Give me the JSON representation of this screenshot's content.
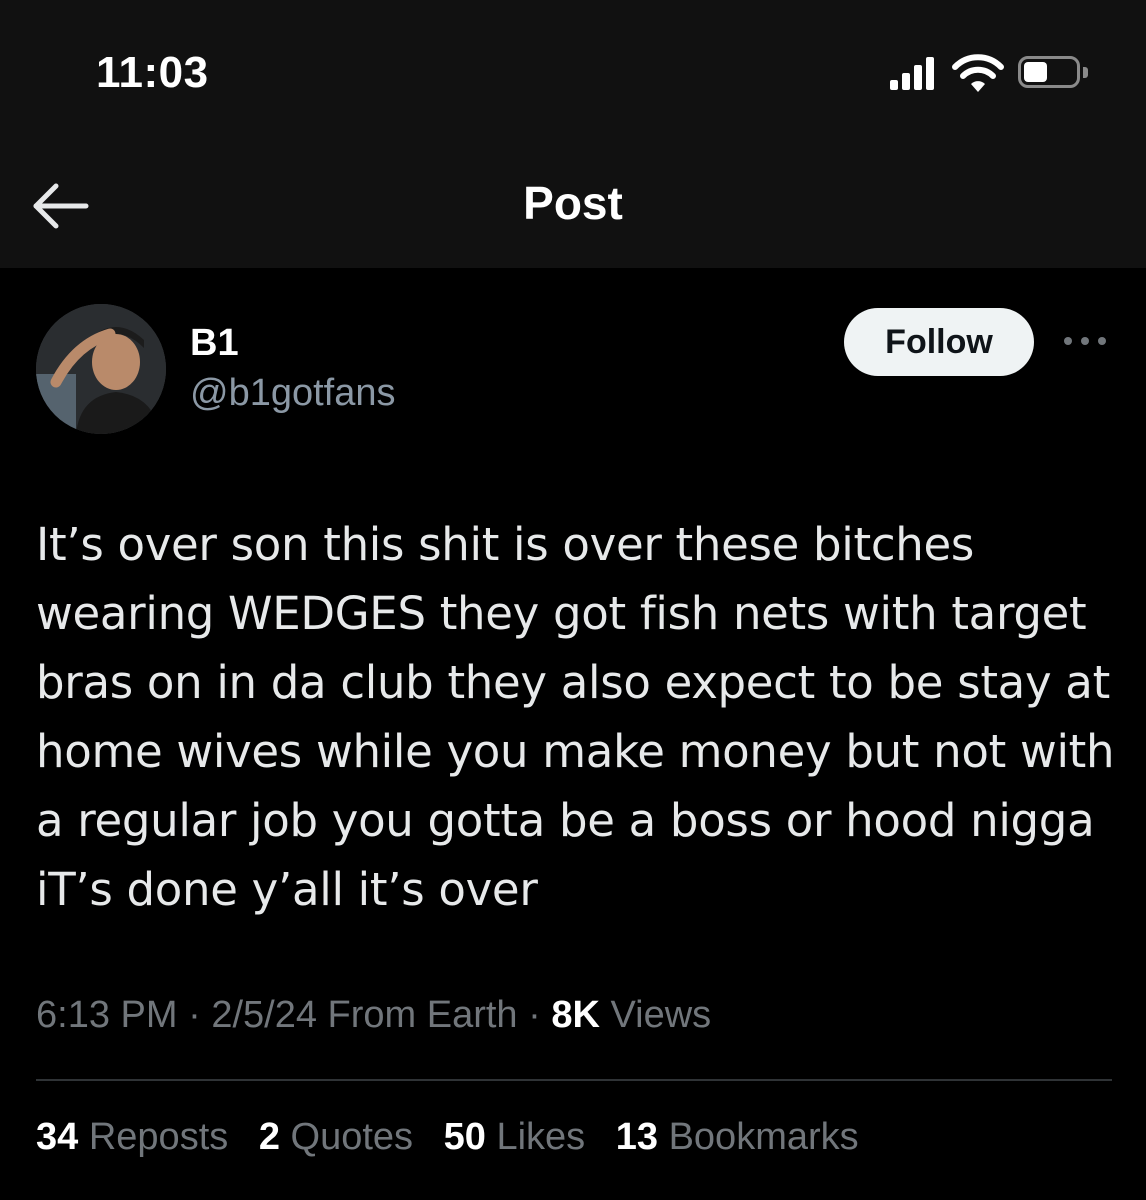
{
  "status_bar": {
    "time": "11:03",
    "signal_bars": 4,
    "battery_level": 0.45
  },
  "header": {
    "title": "Post"
  },
  "author": {
    "name": "B1",
    "handle": "@b1gotfans",
    "follow_label": "Follow"
  },
  "post": {
    "lines": [
      "It’s over son this shit is over these bitches",
      "wearing WEDGES they got fish nets with target",
      "bras on in da club they also expect to be stay at",
      "home wives while you make money but not with",
      "a regular job you gotta be a boss or hood nigga",
      "iT’s done y’all it’s over"
    ]
  },
  "meta": {
    "time": "6:13 PM",
    "separator": "·",
    "date": "2/5/24",
    "location": "From Earth",
    "views_count": "8K",
    "views_label": "Views"
  },
  "stats": {
    "reposts_count": "34",
    "reposts_label": "Reposts",
    "quotes_count": "2",
    "quotes_label": "Quotes",
    "likes_count": "50",
    "likes_label": "Likes",
    "bookmarks_count": "13",
    "bookmarks_label": "Bookmarks"
  },
  "colors": {
    "background": "#000000",
    "header_background": "#111111",
    "primary_text": "#e7e9ea",
    "secondary_text": "#71767b",
    "handle_text": "#8b98a5",
    "follow_bg": "#eff3f4",
    "divider": "#2f3336"
  },
  "icons": {
    "back": "arrow-left-icon",
    "more": "more-horizontal-icon",
    "signal": "cellular-signal-icon",
    "wifi": "wifi-icon",
    "battery": "battery-icon"
  }
}
